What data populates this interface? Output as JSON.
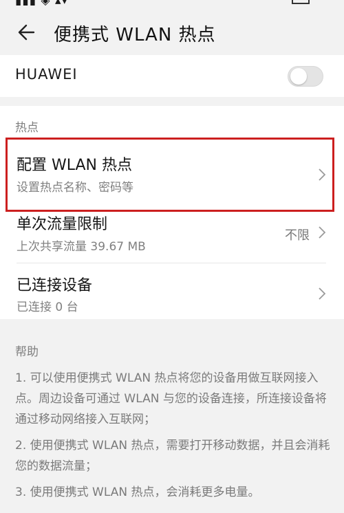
{
  "header": {
    "title": "便携式 WLAN 热点"
  },
  "huawei": {
    "label": "HUAWEI"
  },
  "hotspot": {
    "section_label": "热点",
    "rows": [
      {
        "title": "配置 WLAN 热点",
        "subtitle": "设置热点名称、密码等",
        "value": ""
      },
      {
        "title": "单次流量限制",
        "subtitle": "上次共享流量 39.67 MB",
        "value": "不限"
      },
      {
        "title": "已连接设备",
        "subtitle": "已连接 0 台",
        "value": ""
      }
    ]
  },
  "help": {
    "title": "帮助",
    "items": [
      "1. 可以使用便携式 WLAN 热点将您的设备用做互联网接入点。周边设备可通过 WLAN 与您的设备连接，所连接设备将通过移动网络接入互联网；",
      "2. 使用便携式 WLAN 热点，需要打开移动数据，并且会消耗您的数据流量；",
      "3. 使用便携式 WLAN 热点，会消耗更多电量。"
    ]
  },
  "colors": {
    "highlight": "#cc1f1f",
    "toggle_off": "#e4e4e4"
  }
}
